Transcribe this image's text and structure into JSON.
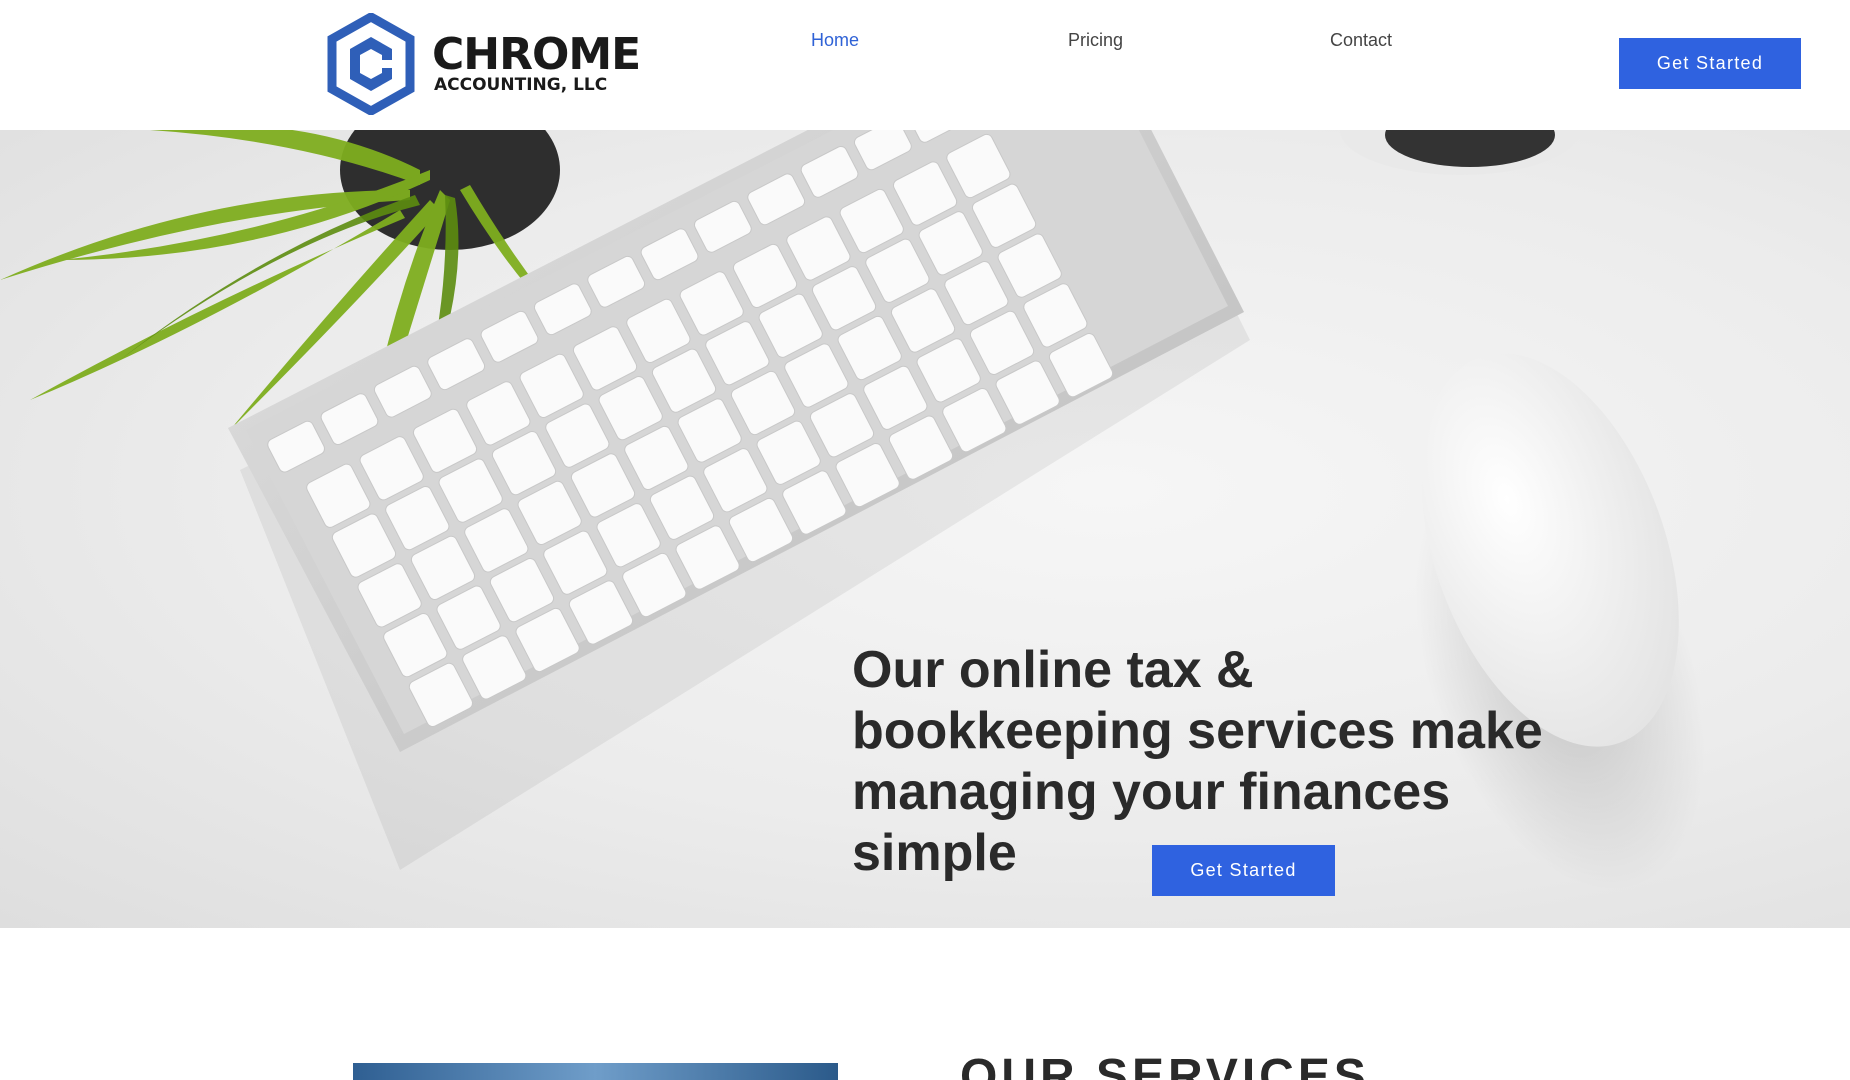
{
  "brand": {
    "name": "CHROME",
    "subtitle": "ACCOUNTING, LLC",
    "color": "#2f5fb8"
  },
  "nav": {
    "items": [
      {
        "label": "Home",
        "active": true
      },
      {
        "label": "Pricing",
        "active": false
      },
      {
        "label": "Contact",
        "active": false
      }
    ],
    "cta_label": "Get Started"
  },
  "hero": {
    "title": "Our online tax & bookkeeping services make managing your finances simple",
    "cta_label": "Get Started"
  },
  "services": {
    "heading": "OUR SERVICES"
  },
  "colors": {
    "accent": "#2f62e0",
    "active_link": "#2f62d6",
    "text": "#2a2a2a"
  }
}
